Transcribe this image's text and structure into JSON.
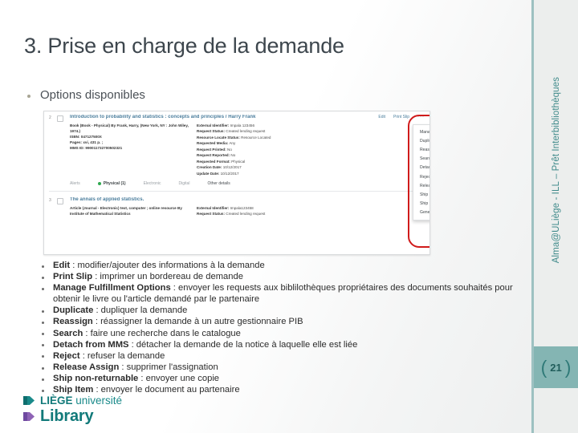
{
  "slide": {
    "title": "3. Prise en charge de la demande",
    "lead_bullet": "Options disponibles"
  },
  "screenshot": {
    "records": [
      {
        "num": "2",
        "title": "Introduction to probability and statistics : concepts and principles / Harry Frank",
        "left_lines": [
          "Book (Book - Physical) By Frank, Harry, (New York, NY : John Wiley, 1974.)",
          "ISBN: 047127500X",
          "Pages: xvi, 431 p. ;",
          "MMS ID: 990011732700502321"
        ],
        "right_fields": [
          {
            "label": "External Identifier:",
            "value": "Impala 123456"
          },
          {
            "label": "Request Status:",
            "value": "Created lending request"
          },
          {
            "label": "Resource Locate Status:",
            "value": "Resource Located"
          },
          {
            "label": "Requested Media:",
            "value": "Any"
          },
          {
            "label": "Request Printed:",
            "value": "No"
          },
          {
            "label": "Request Reported:",
            "value": "No"
          },
          {
            "label": "Requested Format:",
            "value": "Physical"
          },
          {
            "label": "Creation Date:",
            "value": "10/12/2017"
          },
          {
            "label": "Update Date:",
            "value": "10/12/2017"
          }
        ],
        "tabs": [
          "Alerts",
          "Physical (1)",
          "Electronic",
          "Digital",
          "Other details"
        ]
      },
      {
        "num": "3",
        "title": "The annals of applied statistics.",
        "left_lines": [
          "Article (Journal - Electronic) text, computer ; online resource By Institute of Mathematical Statistics"
        ],
        "right_fields": [
          {
            "label": "External Identifier:",
            "value": "Impala123458"
          },
          {
            "label": "Request Status:",
            "value": "Created lending request"
          }
        ]
      }
    ],
    "action_bar": {
      "edit": "Edit",
      "print_slip": "Print Slip",
      "more": "···"
    },
    "menu_items": [
      "Manage Fulfillment Options",
      "Duplicate",
      "Reassign",
      "Search",
      "Detach from MMS",
      "Reject",
      "Release Assign",
      "Ship non-returnable",
      "Ship Item",
      "General Message"
    ],
    "highlight_color": "#d01b1b"
  },
  "options": [
    {
      "term": "Edit",
      "desc": " : modifier/ajouter des informations à la demande"
    },
    {
      "term": "Print Slip",
      "desc": " : imprimer un  bordereau de demande"
    },
    {
      "term": "Manage Fulfillment Options",
      "desc": " : envoyer les requests aux biblilothèques propriétaires des documents souhaités pour obtenir le livre ou l'article demandé par le partenaire"
    },
    {
      "term": "Duplicate",
      "desc": " : dupliquer la demande"
    },
    {
      "term": "Reassign",
      "desc": " : réassigner la demande à un autre gestionnaire PIB"
    },
    {
      "term": "Search",
      "desc": " : faire une recherche dans le catalogue"
    },
    {
      "term": "Detach from MMS",
      "desc": " : détacher la demande de la notice à laquelle elle est liée"
    },
    {
      "term": "Reject",
      "desc": " : refuser la demande"
    },
    {
      "term": "Release Assign",
      "desc": " : supprimer l'assignation"
    },
    {
      "term": "Ship non-returnable",
      "desc": " : envoyer une copie"
    },
    {
      "term": "Ship Item",
      "desc": " : envoyer le document au partenaire"
    }
  ],
  "sidebar": {
    "vertical_text": "Alma@ULiège - ILL – Prêt Interbibliothèques",
    "page_number": "21",
    "bracket_left": "(",
    "bracket_right": ")",
    "accent_color": "#84b5b3",
    "rule_color": "#9dc1c1"
  },
  "logo": {
    "line1_bold": "LIÈGE",
    "line1_rest": "université",
    "line2": "Library",
    "teal": "#127a7a",
    "purple": "#8e63b5"
  }
}
